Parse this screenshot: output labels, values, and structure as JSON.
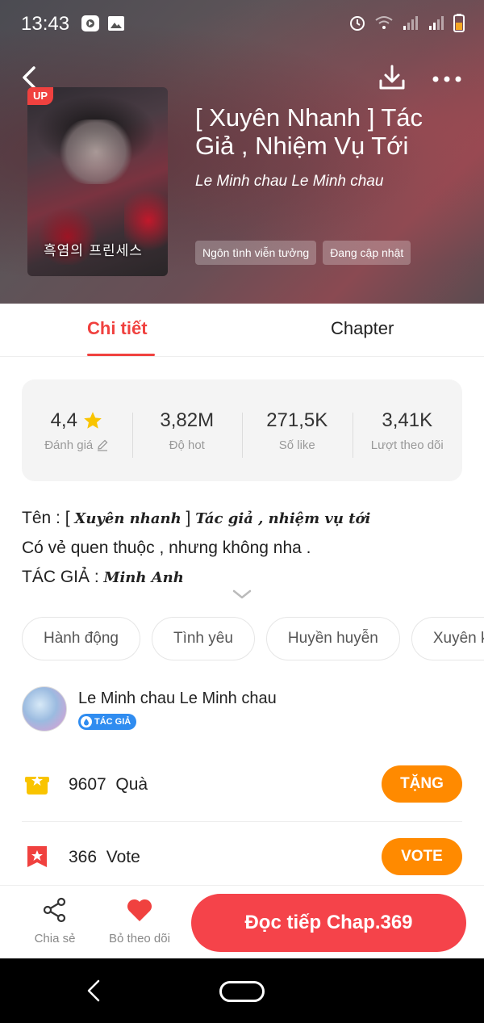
{
  "status_bar": {
    "time": "13:43"
  },
  "header": {
    "title": "[ Xuyên Nhanh ] Tác Giả , Nhiệm Vụ Tới",
    "author": "Le Minh chau Le Minh chau",
    "up_badge": "UP",
    "cover_text": "흑염의 프린세스",
    "genres": [
      "Ngôn tình viễn tưởng",
      "Đang cập nhật"
    ]
  },
  "tabs": [
    {
      "label": "Chi tiết",
      "active": true
    },
    {
      "label": "Chapter",
      "active": false
    }
  ],
  "stats": [
    {
      "value": "4,4",
      "label": "Đánh giá",
      "icon": "star-icon"
    },
    {
      "value": "3,82M",
      "label": "Độ hot"
    },
    {
      "value": "271,5K",
      "label": "Số like"
    },
    {
      "value": "3,41K",
      "label": "Lượt theo dõi"
    }
  ],
  "description": {
    "line1_prefix": "Tên : [ ",
    "line1_fancy_a": "Xuyên nhanh",
    "line1_mid": " ] ",
    "line1_fancy_b": "Tác giả , nhiệm vụ tới",
    "line2": "Có vẻ quen thuộc , nhưng không nha .",
    "line3_prefix": "TÁC GIẢ : ",
    "line3_fancy": "Minh Anh"
  },
  "tags": [
    "Hành động",
    "Tình yêu",
    "Huyền huyễn",
    "Xuyên k"
  ],
  "author_row": {
    "name": "Le Minh chau Le Minh chau",
    "badge": "TÁC GIẢ"
  },
  "gift": {
    "count": "9607",
    "label": "Quà",
    "button": "TẶNG"
  },
  "vote": {
    "count": "366",
    "label": "Vote",
    "button": "VOTE"
  },
  "bottom_bar": {
    "share_label": "Chia sẻ",
    "unfollow_label": "Bỏ theo dõi",
    "read_button": "Đọc tiếp Chap.369"
  },
  "colors": {
    "accent": "#f0413f",
    "orange": "#ff8a00",
    "badge_blue": "#2f8cf0",
    "star": "#f9c400"
  }
}
